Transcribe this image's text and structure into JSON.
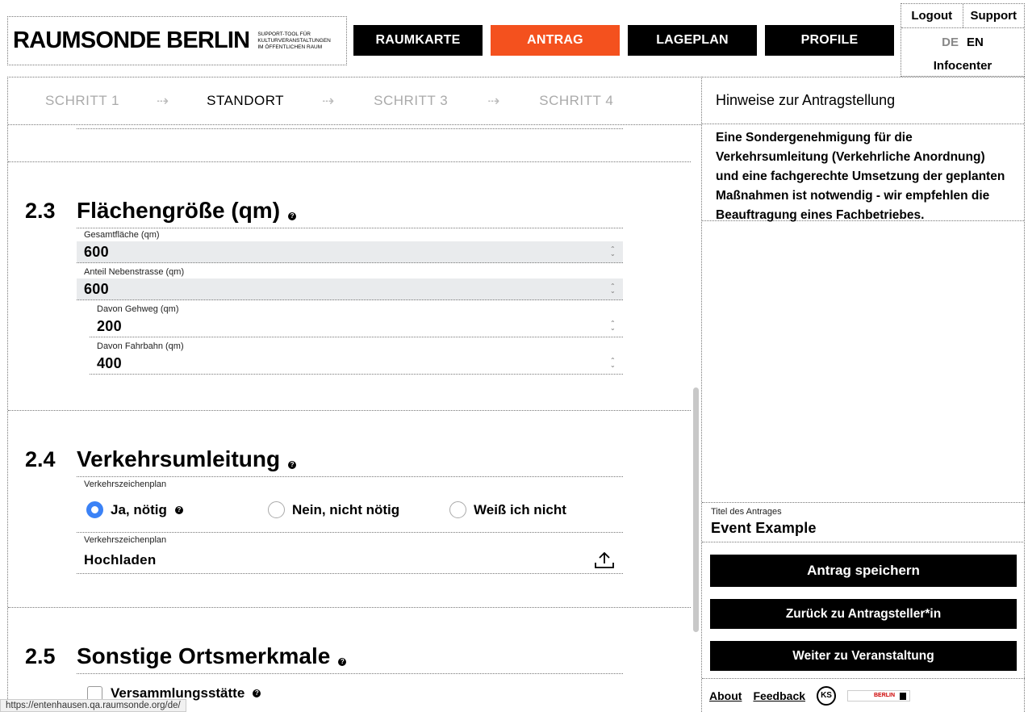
{
  "header": {
    "logo_title": "RAUMSONDE BERLIN",
    "logo_subtitle": "SUPPORT-TOOL FÜR KULTURVERANSTALTUNGEN IM ÖFFENTLICHEN RAUM",
    "nav": [
      "RAUMKARTE",
      "ANTRAG",
      "LAGEPLAN",
      "PROFILE"
    ],
    "nav_active": "ANTRAG",
    "logout": "Logout",
    "support": "Support",
    "lang_de": "DE",
    "lang_en": "EN",
    "infocenter": "Infocenter"
  },
  "steps": [
    "SCHRITT 1",
    "STANDORT",
    "SCHRITT 3",
    "SCHRITT 4"
  ],
  "section_23": {
    "number": "2.3",
    "title": "Flächengröße (qm)",
    "fields": [
      {
        "label": "Gesamtfläche (qm)",
        "value": "600"
      },
      {
        "label": "Anteil Nebenstrasse (qm)",
        "value": "600"
      },
      {
        "label": "Davon Gehweg (qm)",
        "value": "200"
      },
      {
        "label": "Davon Fahrbahn (qm)",
        "value": "400"
      }
    ]
  },
  "section_24": {
    "number": "2.4",
    "title": "Verkehrsumleitung",
    "radio_label": "Verkehrszeichenplan",
    "options": [
      "Ja, nötig",
      "Nein, nicht nötig",
      "Weiß ich nicht"
    ],
    "selected": "Ja, nötig",
    "upload_label": "Verkehrszeichenplan",
    "upload_value": "Hochladen"
  },
  "section_25": {
    "number": "2.5",
    "title": "Sonstige Ortsmerkmale",
    "checkbox": "Versammlungsstätte"
  },
  "aside": {
    "heading": "Hinweise zur Antragstellung",
    "body": "Eine Sondergenehmigung für die Verkehrsumleitung (Verkehrliche Anordnung) und eine fachgerechte Umsetzung der geplanten Maßnahmen ist notwendig - wir empfehlen die Beauftragung eines Fachbetriebes.",
    "title_label": "Titel des Antrages",
    "title_value": "Event Example",
    "btn_save": "Antrag speichern",
    "btn_back": "Zurück zu Antragsteller*in",
    "btn_next": "Weiter zu Veranstaltung",
    "footer_about": "About",
    "footer_feedback": "Feedback",
    "ks_logo_text": "KS",
    "berlin_logo_text": "BERLIN"
  },
  "statusbar": "https://entenhausen.qa.raumsonde.org/de/"
}
